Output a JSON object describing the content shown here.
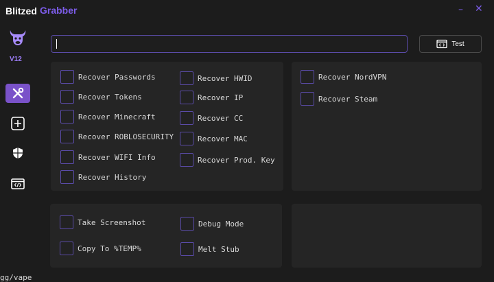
{
  "app": {
    "title_part1": "Blitzed",
    "title_part2": "Grabber",
    "version": "V12"
  },
  "window_controls": {
    "minimize": "–",
    "close": "✕"
  },
  "sidebar": {
    "nav": [
      "tools-icon",
      "add-box-icon",
      "shield-icon",
      "code-icon"
    ]
  },
  "search": {
    "value": "",
    "placeholder": ""
  },
  "test_button": {
    "label": "Test",
    "icon": "code-icon"
  },
  "options": {
    "col1": [
      "Recover Passwords",
      "Recover Tokens",
      "Recover Minecraft",
      "Recover ROBLOSECURITY",
      "Recover WIFI Info",
      "Recover History"
    ],
    "col2": [
      "Recover HWID",
      "Recover IP",
      "Recover CC",
      "Recover MAC",
      "Recover Prod. Key"
    ],
    "col3": [
      "Recover NordVPN",
      "Recover Steam"
    ]
  },
  "misc": {
    "screenshot": "Take Screenshot",
    "copy_temp": "Copy To %TEMP%",
    "debug": "Debug Mode",
    "melt": "Melt Stub"
  },
  "footer": {
    "text": "gg/vape"
  },
  "colors": {
    "accent": "#7c5ce8",
    "nav_active": "#7a52c9",
    "background": "#1c1c1c",
    "panel": "#252525"
  }
}
